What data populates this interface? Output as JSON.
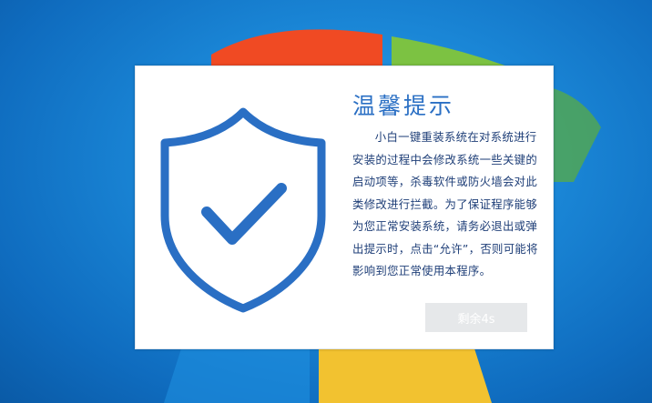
{
  "dialog": {
    "title": "温馨提示",
    "message": "小白一键重装系统在对系统进行安装的过程中会修改系统一些关键的启动项等，杀毒软件或防火墙会对此类修改进行拦截。为了保证程序能够为您正常安装系统，请务必退出或弹出提示时，点击“允许”，否则可能将影响到您正常使用本程序。",
    "countdown_button": "剩余4s",
    "icon": "shield-check-icon",
    "accent_color": "#2a6fc4"
  },
  "background": {
    "icon": "windows-logo-icon"
  }
}
